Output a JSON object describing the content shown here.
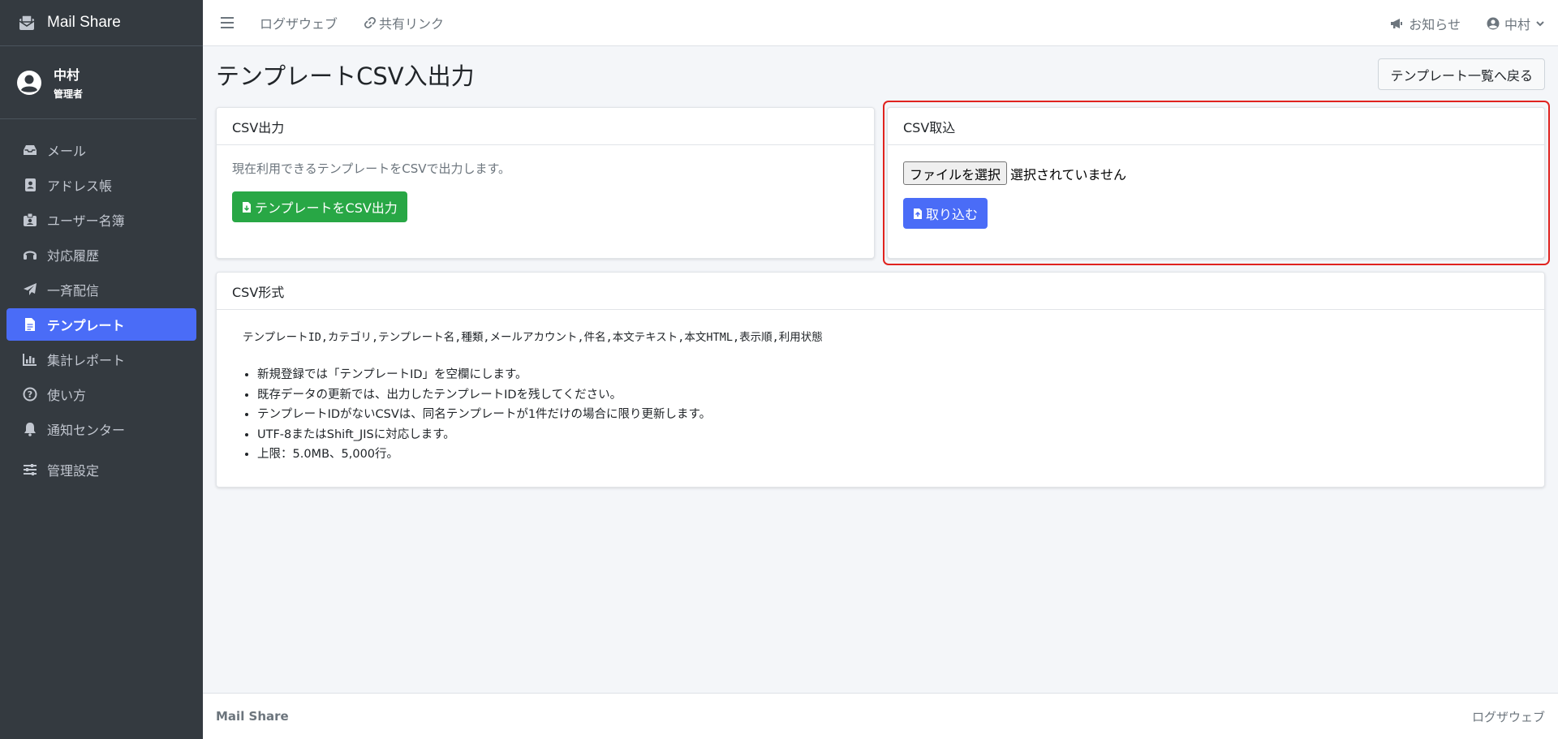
{
  "app": {
    "name": "Mail Share"
  },
  "user": {
    "name": "中村",
    "role": "管理者"
  },
  "sidebar": {
    "items": [
      {
        "label": "メール",
        "icon": "inbox-icon"
      },
      {
        "label": "アドレス帳",
        "icon": "address-book-icon"
      },
      {
        "label": "ユーザー名簿",
        "icon": "id-badge-icon"
      },
      {
        "label": "対応履歴",
        "icon": "headset-icon"
      },
      {
        "label": "一斉配信",
        "icon": "paper-plane-icon"
      },
      {
        "label": "テンプレート",
        "icon": "file-icon",
        "active": true
      },
      {
        "label": "集計レポート",
        "icon": "bar-chart-icon"
      },
      {
        "label": "使い方",
        "icon": "question-circle-icon"
      },
      {
        "label": "通知センター",
        "icon": "bell-icon"
      },
      {
        "label": "管理設定",
        "icon": "sliders-icon"
      }
    ]
  },
  "header": {
    "links": [
      {
        "label": "ログザウェブ"
      },
      {
        "label": "共有リンク",
        "icon": "link-icon"
      }
    ],
    "notifications_label": "お知らせ",
    "user_menu_label": "中村"
  },
  "page": {
    "title": "テンプレートCSV入出力",
    "back_label": "テンプレート一覧へ戻る"
  },
  "export_card": {
    "title": "CSV出力",
    "description": "現在利用できるテンプレートをCSVで出力します。",
    "button_label": "テンプレートをCSV出力"
  },
  "import_card": {
    "title": "CSV取込",
    "file_button_label": "ファイルを選択",
    "file_status": "選択されていません",
    "button_label": "取り込む"
  },
  "format_card": {
    "title": "CSV形式",
    "columns_line": "テンプレートID,カテゴリ,テンプレート名,種類,メールアカウント,件名,本文テキスト,本文HTML,表示順,利用状態",
    "rules": [
      "新規登録では「テンプレートID」を空欄にします。",
      "既存データの更新では、出力したテンプレートIDを残してください。",
      "テンプレートIDがないCSVは、同名テンプレートが1件だけの場合に限り更新します。",
      "UTF-8またはShift_JISに対応します。",
      "上限：5.0MB、5,000行。"
    ]
  },
  "footer": {
    "brand": "Mail Share",
    "right_text": "ログザウェブ"
  },
  "colors": {
    "sidebar_bg": "#343a40",
    "accent": "#4a6cf7",
    "success": "#28a745",
    "highlight": "#e0231f"
  }
}
